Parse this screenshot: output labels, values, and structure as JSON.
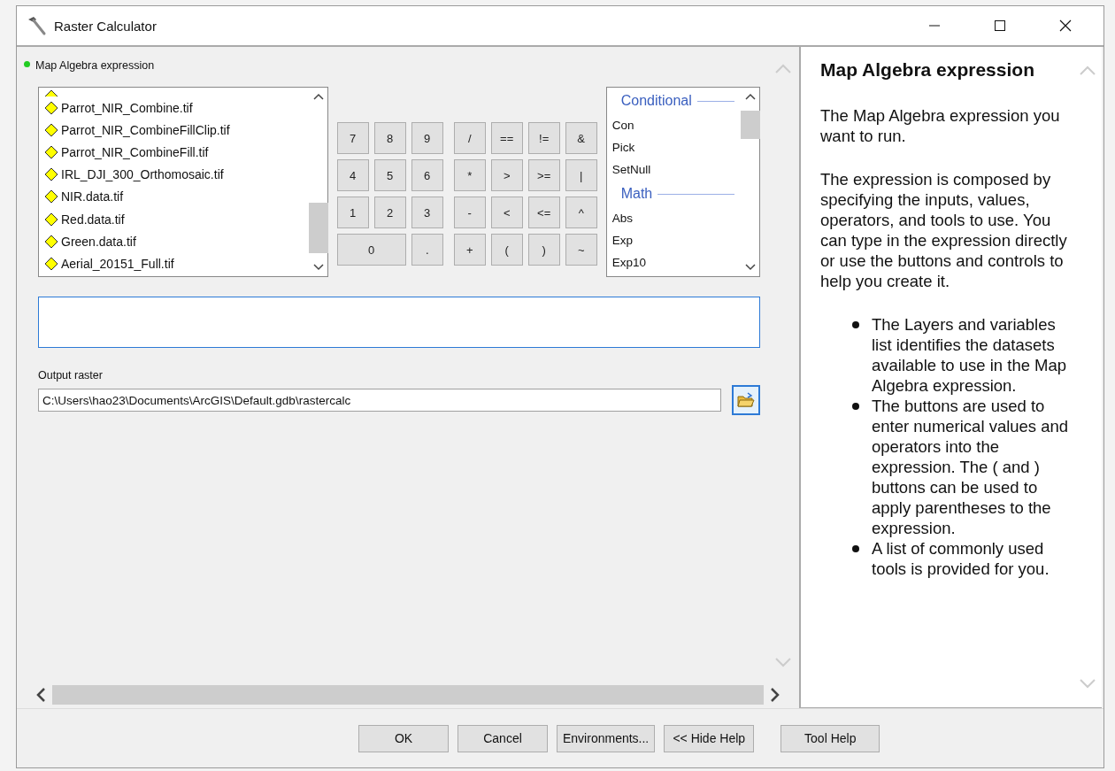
{
  "window": {
    "title": "Raster Calculator"
  },
  "expression_label": "Map Algebra expression",
  "layers": [
    "Parrot_NIR_Combine.tif",
    "Parrot_NIR_CombineFillClip.tif",
    "Parrot_NIR_CombineFill.tif",
    "IRL_DJI_300_Orthomosaic.tif",
    "NIR.data.tif",
    "Red.data.tif",
    "Green.data.tif",
    "Aerial_20151_Full.tif"
  ],
  "digit_keys": [
    {
      "label": "7",
      "kind": "key"
    },
    {
      "label": "8",
      "kind": "key"
    },
    {
      "label": "9",
      "kind": "key"
    },
    {
      "label": "4",
      "kind": "key"
    },
    {
      "label": "5",
      "kind": "key"
    },
    {
      "label": "6",
      "kind": "key"
    },
    {
      "label": "1",
      "kind": "key"
    },
    {
      "label": "2",
      "kind": "key"
    },
    {
      "label": "3",
      "kind": "key"
    },
    {
      "label": "0",
      "kind": "wide"
    },
    {
      "label": ".",
      "kind": "key"
    }
  ],
  "operator_keys": [
    "/",
    "==",
    "!=",
    "&",
    "*",
    ">",
    ">=",
    "|",
    "-",
    "<",
    "<=",
    "^",
    "+",
    "(",
    ")",
    "~"
  ],
  "tools": [
    {
      "kind": "header",
      "label": "Conditional"
    },
    {
      "kind": "item",
      "label": "Con"
    },
    {
      "kind": "item",
      "label": "Pick"
    },
    {
      "kind": "item",
      "label": "SetNull"
    },
    {
      "kind": "header",
      "label": "Math"
    },
    {
      "kind": "item",
      "label": "Abs"
    },
    {
      "kind": "item",
      "label": "Exp"
    },
    {
      "kind": "item",
      "label": "Exp10"
    }
  ],
  "output": {
    "label": "Output raster",
    "value": "C:\\Users\\hao23\\Documents\\ArcGIS\\Default.gdb\\rastercalc"
  },
  "buttons": [
    "OK",
    "Cancel",
    "Environments...",
    "<< Hide Help",
    "Tool Help"
  ],
  "help": {
    "title": "Map Algebra expression",
    "paragraphs": [
      "The Map Algebra expression you want to run.",
      "The expression is composed by specifying the inputs, values, operators, and tools to use. You can type in the expression directly or use the buttons and controls to help you create it."
    ],
    "bullets": [
      "The Layers and variables list identifies the datasets available to use in the Map Algebra expression.",
      "The buttons are used to enter numerical values and operators into the expression. The ( and ) buttons can be used to apply parentheses to the expression.",
      "A list of commonly used tools is provided for you."
    ]
  }
}
